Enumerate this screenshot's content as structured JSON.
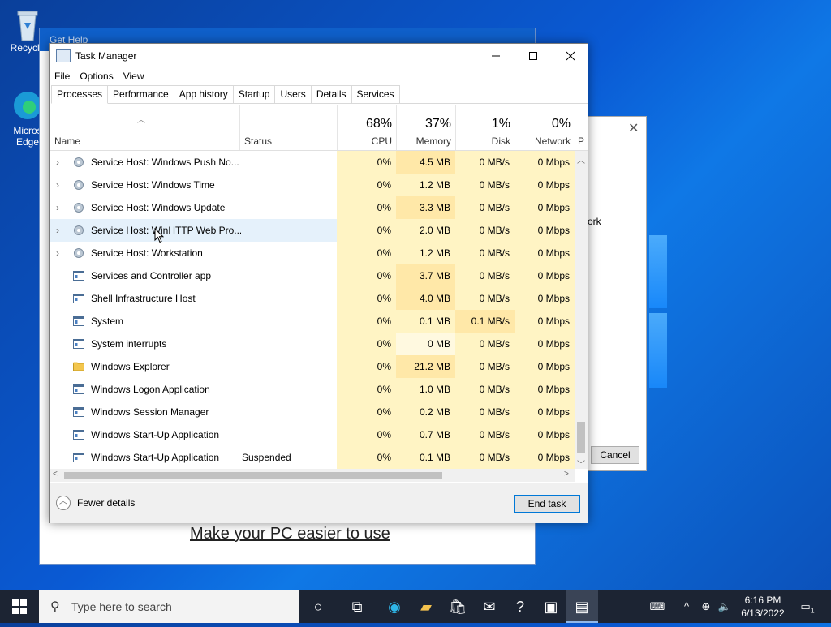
{
  "desktop": {
    "icons": [
      {
        "label": "Recycle"
      },
      {
        "label": "Microsoft Edge",
        "short": "Micros Edge"
      }
    ]
  },
  "gethelp": {
    "title": "Get Help",
    "link": "Make your PC easier to use"
  },
  "dialog2": {
    "fragment": "ork",
    "cancel": "Cancel"
  },
  "taskmanager": {
    "title": "Task Manager",
    "menu": [
      "File",
      "Options",
      "View"
    ],
    "tabs": [
      "Processes",
      "Performance",
      "App history",
      "Startup",
      "Users",
      "Details",
      "Services"
    ],
    "active_tab": "Processes",
    "columns": {
      "name": "Name",
      "status": "Status",
      "cpu": {
        "pct": "68%",
        "label": "CPU"
      },
      "memory": {
        "pct": "37%",
        "label": "Memory"
      },
      "disk": {
        "pct": "1%",
        "label": "Disk"
      },
      "network": {
        "pct": "0%",
        "label": "Network"
      },
      "power_partial": "P"
    },
    "rows": [
      {
        "name": "Service Host: Windows Push No...",
        "status": "",
        "cpu": "0%",
        "memory": "4.5 MB",
        "disk": "0 MB/s",
        "network": "0 Mbps",
        "expandable": true,
        "icon": "gear"
      },
      {
        "name": "Service Host: Windows Time",
        "status": "",
        "cpu": "0%",
        "memory": "1.2 MB",
        "disk": "0 MB/s",
        "network": "0 Mbps",
        "expandable": true,
        "icon": "gear"
      },
      {
        "name": "Service Host: Windows Update",
        "status": "",
        "cpu": "0%",
        "memory": "3.3 MB",
        "disk": "0 MB/s",
        "network": "0 Mbps",
        "expandable": true,
        "icon": "gear"
      },
      {
        "name": "Service Host: WinHTTP Web Pro...",
        "status": "",
        "cpu": "0%",
        "memory": "2.0 MB",
        "disk": "0 MB/s",
        "network": "0 Mbps",
        "expandable": true,
        "icon": "gear",
        "hover": true
      },
      {
        "name": "Service Host: Workstation",
        "status": "",
        "cpu": "0%",
        "memory": "1.2 MB",
        "disk": "0 MB/s",
        "network": "0 Mbps",
        "expandable": true,
        "icon": "gear"
      },
      {
        "name": "Services and Controller app",
        "status": "",
        "cpu": "0%",
        "memory": "3.7 MB",
        "disk": "0 MB/s",
        "network": "0 Mbps",
        "expandable": false,
        "icon": "window"
      },
      {
        "name": "Shell Infrastructure Host",
        "status": "",
        "cpu": "0%",
        "memory": "4.0 MB",
        "disk": "0 MB/s",
        "network": "0 Mbps",
        "expandable": false,
        "icon": "window"
      },
      {
        "name": "System",
        "status": "",
        "cpu": "0%",
        "memory": "0.1 MB",
        "disk": "0.1 MB/s",
        "network": "0 Mbps",
        "expandable": false,
        "icon": "window"
      },
      {
        "name": "System interrupts",
        "status": "",
        "cpu": "0%",
        "memory": "0 MB",
        "disk": "0 MB/s",
        "network": "0 Mbps",
        "expandable": false,
        "icon": "window"
      },
      {
        "name": "Windows Explorer",
        "status": "",
        "cpu": "0%",
        "memory": "21.2 MB",
        "disk": "0 MB/s",
        "network": "0 Mbps",
        "expandable": false,
        "icon": "folder"
      },
      {
        "name": "Windows Logon Application",
        "status": "",
        "cpu": "0%",
        "memory": "1.0 MB",
        "disk": "0 MB/s",
        "network": "0 Mbps",
        "expandable": false,
        "icon": "window"
      },
      {
        "name": "Windows Session Manager",
        "status": "",
        "cpu": "0%",
        "memory": "0.2 MB",
        "disk": "0 MB/s",
        "network": "0 Mbps",
        "expandable": false,
        "icon": "window"
      },
      {
        "name": "Windows Start-Up Application",
        "status": "",
        "cpu": "0%",
        "memory": "0.7 MB",
        "disk": "0 MB/s",
        "network": "0 Mbps",
        "expandable": false,
        "icon": "window"
      },
      {
        "name": "Windows Start-Up Application",
        "status": "Suspended",
        "cpu": "0%",
        "memory": "0.1 MB",
        "disk": "0 MB/s",
        "network": "0 Mbps",
        "expandable": false,
        "icon": "window"
      }
    ],
    "footer": {
      "fewer_details": "Fewer details",
      "end_task": "End task"
    }
  },
  "taskbar": {
    "search_placeholder": "Type here to search",
    "time": "6:16 PM",
    "date": "6/13/2022",
    "notification_count": "1"
  }
}
